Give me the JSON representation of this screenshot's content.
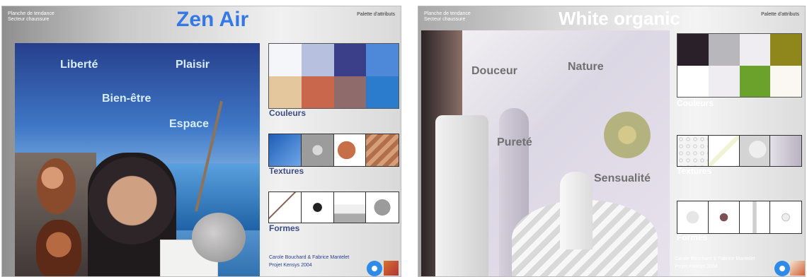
{
  "left_board": {
    "meta_line1": "Planche de tendance",
    "meta_line2": "Secteur chaussure",
    "title": "Zen Air",
    "palette_label": "Palette d'attributs",
    "words": [
      "Liberté",
      "Plaisir",
      "Bien-être",
      "Espace"
    ],
    "colors_label": "Couleurs",
    "textures_label": "Textures",
    "forms_label": "Formes",
    "footer_line1": "Carole Bouchard & Fabrice Mantelet",
    "footer_line2": "Projet Kensys 2004",
    "swatches": [
      "#f5f6fa",
      "#b7c0df",
      "#3b3f8a",
      "#4d89d8",
      "#e5c79d",
      "#c8674c",
      "#8f6b6c",
      "#2b7ccc"
    ],
    "accent": "#3378e6"
  },
  "right_board": {
    "meta_line1": "Planche de tendance",
    "meta_line2": "Secteur chaussure",
    "title": "White organic",
    "palette_label": "Palette d'attributs",
    "words": [
      "Douceur",
      "Nature",
      "Pureté",
      "Sensualité"
    ],
    "colors_label": "Couleurs",
    "textures_label": "Textures",
    "forms_label": "Formes",
    "footer_line1": "Carole Bouchard & Fabrice Mantelet",
    "footer_line2": "Projet Kensys 2004",
    "swatches": [
      "#29202a",
      "#b8b8bc",
      "#efedf1",
      "#8f861c",
      "#ffffff",
      "#efedf1",
      "#6aa22b",
      "#fbf8f2"
    ],
    "accent": "#ffffff"
  }
}
